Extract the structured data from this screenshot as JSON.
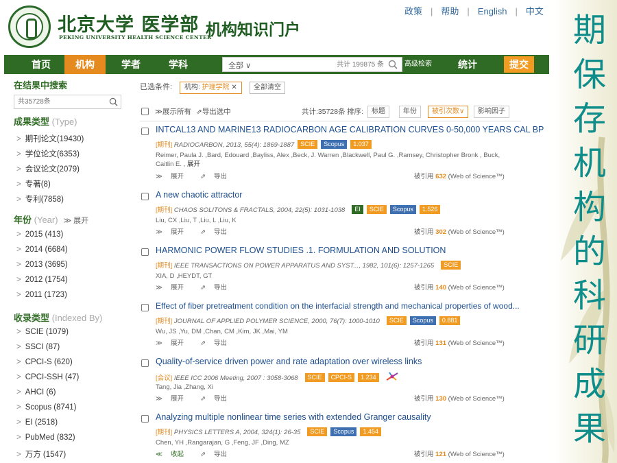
{
  "header": {
    "logo_cn": "北京大学 医学部",
    "logo_en": "PEKING UNIVERSITY HEALTH SCIENCE CENTER",
    "portal_title": "机构知识门户",
    "top_links": [
      "政策",
      "帮助",
      "English",
      "中文"
    ]
  },
  "nav": {
    "items": [
      "首页",
      "机构",
      "学者",
      "学科"
    ],
    "active": "机构",
    "search_scope": "全部",
    "search_placeholder": "共计 199875 条",
    "advanced_search": "高级检索",
    "stats": "统计",
    "submit": "提交"
  },
  "sidebar": {
    "search_title": "在结果中搜索",
    "search_placeholder": "共35728条",
    "type_title": "成果类型",
    "type_title_en": "(Type)",
    "types": [
      "期刊论文(19430)",
      "学位论文(6353)",
      "会议论文(2079)",
      "专著(8)",
      "专利(7858)"
    ],
    "year_title": "年份",
    "year_title_en": "(Year)",
    "year_expand": "展开",
    "years": [
      "2015 (413)",
      "2014 (6684)",
      "2013 (3695)",
      "2012 (1754)",
      "2011 (1723)"
    ],
    "index_title": "收录类型",
    "index_title_en": "(Indexed By)",
    "indexes": [
      "SCIE (1079)",
      "SSCI (87)",
      "CPCI-S (620)",
      "CPCI-SSH (47)",
      "AHCI (6)",
      "Scopus (8741)",
      "EI (2518)",
      "PubMed (832)",
      "万方 (1547)"
    ]
  },
  "filter": {
    "label": "已选条件:",
    "tag_key": "机构:",
    "tag_value": "护理学院",
    "clear_all": "全部清空"
  },
  "toolbar": {
    "show_all": "展示所有",
    "export_selected": "导出选中",
    "total": "共计:35728条",
    "sort_label": "排序:",
    "sort_options": [
      "标题",
      "年份",
      "被引次数",
      "影响因子"
    ]
  },
  "records": [
    {
      "title": "INTCAL13 AND MARINE13 RADIOCARBON AGE CALIBRATION CURVES 0-50,000 YEARS CAL BP",
      "type": "[期刊]",
      "source": "RADIOCARBON, 2013, 55(4): 1869-1887",
      "badges": [
        "SCIE",
        "Scopus",
        "1.037"
      ],
      "authors": "Reimer, Paula J. ,Bard, Edouard ,Bayliss, Alex ,Beck, J. Warren ,Blackwell, Paul G. ,Ramsey, Christopher Bronk , Buck, Caitlin E. ,",
      "more": "展开",
      "action_expand": "展开",
      "action_export": "导出",
      "cited_prefix": "被引用",
      "cited": "632",
      "cited_suffix": "(Web of Science™)"
    },
    {
      "title": "A new chaotic attractor",
      "type": "[期刊]",
      "source": "CHAOS SOLITONS & FRACTALS, 2004, 22(5): 1031-1038",
      "badges": [
        "EI",
        "SCIE",
        "Scopus",
        "1.526"
      ],
      "authors": "Liu, CX ,Liu, T ,Liu, L ,Liu, K",
      "action_expand": "展开",
      "action_export": "导出",
      "cited_prefix": "被引用",
      "cited": "302",
      "cited_suffix": "(Web of Science™)"
    },
    {
      "title": "HARMONIC POWER FLOW STUDIES .1. FORMULATION AND SOLUTION",
      "type": "[期刊]",
      "source": "IEEE TRANSACTIONS ON POWER APPARATUS AND SYST..., 1982, 101(6): 1257-1265",
      "badges": [
        "SCIE"
      ],
      "authors": "XIA, D ,HEYDT, GT",
      "action_expand": "展开",
      "action_export": "导出",
      "cited_prefix": "被引用",
      "cited": "140",
      "cited_suffix": "(Web of Science™)"
    },
    {
      "title": "Effect of fiber pretreatment condition on the interfacial strength and mechanical properties of wood...",
      "type": "[期刊]",
      "source": "JOURNAL OF APPLIED POLYMER SCIENCE, 2000, 76(7): 1000-1010",
      "badges": [
        "SCIE",
        "Scopus",
        "0.881"
      ],
      "authors": "Wu, JS ,Yu, DM ,Chan, CM ,Kim, JK ,Mai, YM",
      "action_expand": "展开",
      "action_export": "导出",
      "cited_prefix": "被引用",
      "cited": "131",
      "cited_suffix": "(Web of Science™)"
    },
    {
      "title": "Quality-of-service driven power and rate adaptation over wireless links",
      "type": "[会议]",
      "source": "IEEE ICC 2006 Meeting, 2007 : 3058-3068",
      "badges": [
        "SCIE",
        "CPCI-S",
        "1.234"
      ],
      "authors": "Tang, Jia ,Zhang, Xi",
      "action_expand": "展开",
      "action_export": "导出",
      "cited_prefix": "被引用",
      "cited": "130",
      "cited_suffix": "(Web of Science™)"
    },
    {
      "title": "Analyzing multiple nonlinear time series with extended Granger causality",
      "type": "[期刊]",
      "source": "PHYSICS LETTERS A, 2004, 324(1): 26-35",
      "badges": [
        "SCIE",
        "Scopus",
        "1.454"
      ],
      "authors": "Chen, YH ,Rangarajan, G ,Feng, JF ,Ding, MZ",
      "action_expand": "收起",
      "action_export": "导出",
      "cited_prefix": "被引用",
      "cited": "121",
      "cited_suffix": "(Web of Science™)"
    }
  ],
  "deco_text": [
    "期",
    "保",
    "存",
    "机",
    "构",
    "的",
    "科",
    "研",
    "成",
    "果"
  ],
  "colors": {
    "nav_green": "#2f6b24",
    "accent_orange": "#e58a1f",
    "link_blue": "#1d4e8f",
    "deco_teal": "#0f8d8a"
  }
}
